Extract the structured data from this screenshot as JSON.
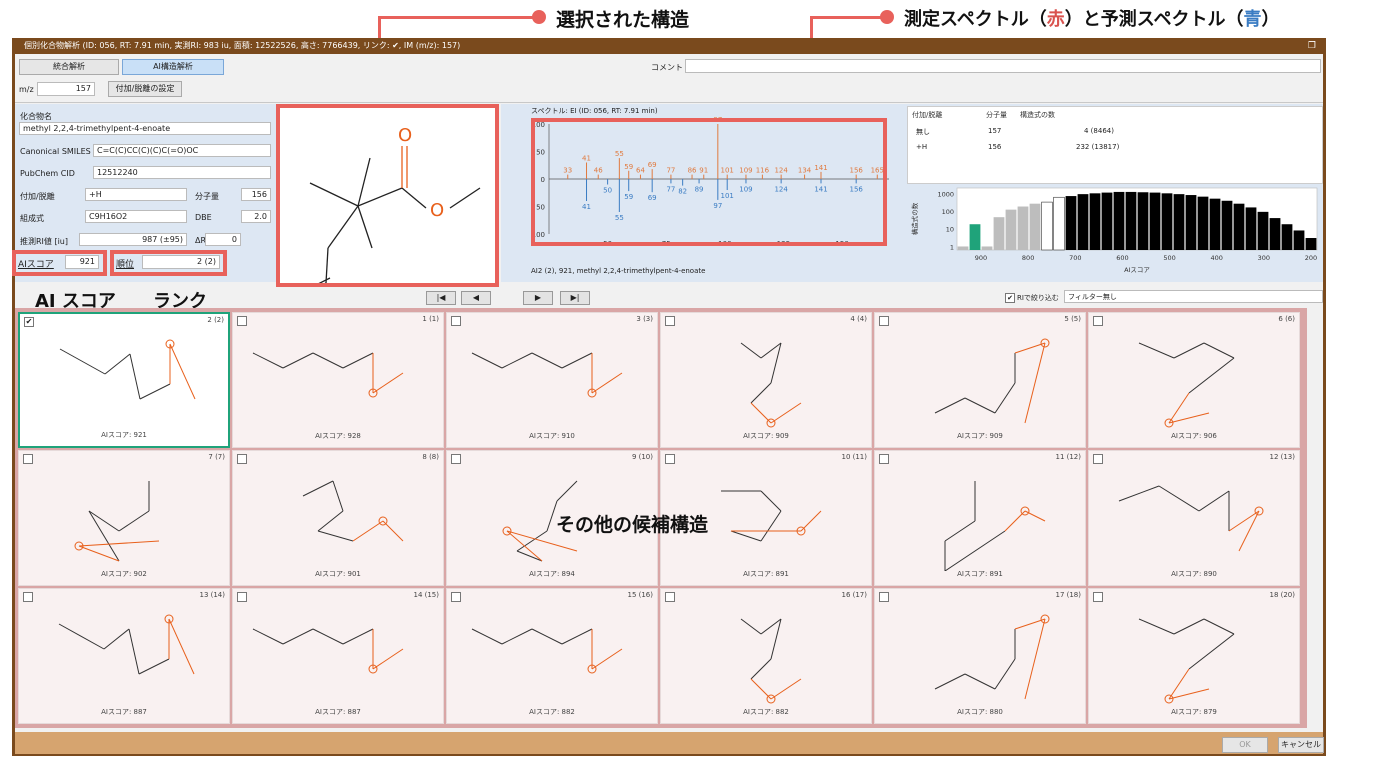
{
  "annotations": {
    "selected": "選択された構造",
    "spec_pre": "測定スペクトル（",
    "spec_red": "赤",
    "spec_mid": "）と予測スペクトル（",
    "spec_blue": "青",
    "spec_post": "）",
    "score_label": "AI スコア",
    "rank_label": "ランク",
    "others": "その他の候補構造"
  },
  "window": {
    "title": "個別化合物解析 (ID: 056, RT: 7.91 min, 実測RI: 983 iu, 面積: 12522526, 高さ: 7766439, リンク: ✔, IM (m/z): 157)",
    "restore": "❐"
  },
  "tabs": {
    "integrated": "統合解析",
    "ai": "AI構造解析"
  },
  "mz": {
    "label": "m/z",
    "value": "157",
    "adduct_btn": "付加/脱離の設定"
  },
  "comment": {
    "label": "コメント",
    "value": ""
  },
  "info": {
    "name_label": "化合物名",
    "name": "methyl 2,2,4-trimethylpent-4-enoate",
    "smiles_label": "Canonical SMILES",
    "smiles": "C=C(C)CC(C)(C)C(=O)OC",
    "cid_label": "PubChem CID",
    "cid": "12512240",
    "adduct_label": "付加/脱離",
    "adduct": "+H",
    "mw_label": "分子量",
    "mw": "156",
    "formula_label": "組成式",
    "formula": "C9H16O2",
    "dbe_label": "DBE",
    "dbe": "2.0",
    "ri_label": "推測RI値 [iu]",
    "ri": "987 (±95)",
    "dri_label": "ΔRI [iu]",
    "dri": "0",
    "ai_label": "AIスコア",
    "ai": "921",
    "rank_label": "順位",
    "rank": "2 (2)"
  },
  "spectrum": {
    "title": "スペクトル: EI (ID: 056, RT: 7.91 min)",
    "caption": "AI2 (2), 921, methyl 2,2,4-trimethylpent-4-enoate"
  },
  "chart_data": [
    {
      "type": "bar",
      "title": "スペクトル: EI (ID: 056, RT: 7.91 min)",
      "xlim": [
        25,
        170
      ],
      "ylim": [
        -100,
        100
      ],
      "x_ticks": [
        50,
        75,
        100,
        125,
        150
      ],
      "y_ticks": [
        100,
        50,
        0,
        50,
        100
      ],
      "series": [
        {
          "name": "測定",
          "color": "#e07a3f",
          "x": [
            33,
            41,
            46,
            55,
            59,
            64,
            69,
            77,
            86,
            91,
            97,
            101,
            109,
            116,
            124,
            134,
            141,
            156,
            165
          ],
          "y": [
            8,
            30,
            8,
            38,
            15,
            8,
            18,
            8,
            8,
            8,
            100,
            8,
            8,
            8,
            8,
            8,
            13,
            8,
            8
          ]
        },
        {
          "name": "予測",
          "color": "#3a7cc3",
          "x": [
            41,
            50,
            55,
            59,
            69,
            77,
            82,
            89,
            97,
            101,
            109,
            124,
            141,
            156
          ],
          "y": [
            -40,
            -10,
            -60,
            -22,
            -24,
            -8,
            -12,
            -8,
            -38,
            -20,
            -8,
            -8,
            -8,
            -8
          ]
        }
      ]
    },
    {
      "type": "bar",
      "xlabel": "AIスコア",
      "ylabel": "構造式の数",
      "x_ticks": [
        900,
        800,
        700,
        600,
        500,
        400,
        300,
        200
      ],
      "y_ticks": [
        "1000",
        "100",
        "10",
        "1"
      ],
      "selected_color": "#1fa37a",
      "values": [
        1,
        18,
        1,
        45,
        120,
        180,
        260,
        320,
        600,
        700,
        900,
        1000,
        1100,
        1200,
        1200,
        1150,
        1100,
        1000,
        900,
        800,
        650,
        500,
        380,
        260,
        160,
        90,
        40,
        18,
        8,
        3
      ]
    }
  ],
  "adduct_table": {
    "headers": [
      "付加/脱離",
      "分子量",
      "構造式の数"
    ],
    "rows": [
      [
        "無し",
        "157",
        "4 (8464)"
      ],
      [
        "+H",
        "156",
        "232 (13817)"
      ]
    ]
  },
  "filter": {
    "ri_label": "RIで絞り込む",
    "ri_checked": "✔",
    "filter_value": "フィルター無し"
  },
  "nav": {
    "first": "|◀",
    "prev": "◀",
    "next": "▶",
    "last": "▶|"
  },
  "candidates": [
    {
      "rank": "2 (2)",
      "score": "AIスコア: 921",
      "checked": "✔"
    },
    {
      "rank": "1 (1)",
      "score": "AIスコア: 928",
      "checked": ""
    },
    {
      "rank": "3 (3)",
      "score": "AIスコア: 910",
      "checked": ""
    },
    {
      "rank": "4 (4)",
      "score": "AIスコア: 909",
      "checked": ""
    },
    {
      "rank": "5 (5)",
      "score": "AIスコア: 909",
      "checked": ""
    },
    {
      "rank": "6 (6)",
      "score": "AIスコア: 906",
      "checked": ""
    },
    {
      "rank": "7 (7)",
      "score": "AIスコア: 902",
      "checked": ""
    },
    {
      "rank": "8 (8)",
      "score": "AIスコア: 901",
      "checked": ""
    },
    {
      "rank": "9 (10)",
      "score": "AIスコア: 894",
      "checked": ""
    },
    {
      "rank": "10 (11)",
      "score": "AIスコア: 891",
      "checked": ""
    },
    {
      "rank": "11 (12)",
      "score": "AIスコア: 891",
      "checked": ""
    },
    {
      "rank": "12 (13)",
      "score": "AIスコア: 890",
      "checked": ""
    },
    {
      "rank": "13 (14)",
      "score": "AIスコア: 887",
      "checked": ""
    },
    {
      "rank": "14 (15)",
      "score": "AIスコア: 887",
      "checked": ""
    },
    {
      "rank": "15 (16)",
      "score": "AIスコア: 882",
      "checked": ""
    },
    {
      "rank": "16 (17)",
      "score": "AIスコア: 882",
      "checked": ""
    },
    {
      "rank": "17 (18)",
      "score": "AIスコア: 880",
      "checked": ""
    },
    {
      "rank": "18 (20)",
      "score": "AIスコア: 879",
      "checked": ""
    }
  ],
  "footer": {
    "ok": "OK",
    "cancel": "キャンセル"
  }
}
